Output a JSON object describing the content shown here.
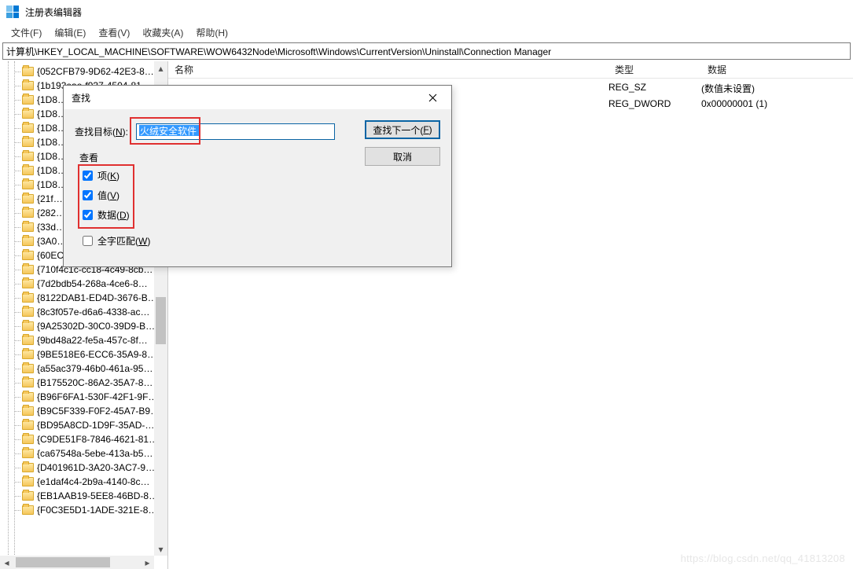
{
  "window": {
    "title": "注册表编辑器"
  },
  "menu": {
    "file": "文件(F)",
    "edit": "编辑(E)",
    "view": "查看(V)",
    "favorites": "收藏夹(A)",
    "help": "帮助(H)"
  },
  "address": "计算机\\HKEY_LOCAL_MACHINE\\SOFTWARE\\WOW6432Node\\Microsoft\\Windows\\CurrentVersion\\Uninstall\\Connection Manager",
  "tree": {
    "items": [
      "{052CFB79-9D62-42E3-8…",
      "{1b193eae-f937-4504-81…",
      "{1D8…",
      "{1D8…",
      "{1D8…",
      "{1D8…",
      "{1D8…",
      "{1D8…",
      "{1D8…",
      "{21f…",
      "{282…",
      "{33d…",
      "{3A0…",
      "{60EC980A-BDA2-4CB6-A…",
      "{710f4c1c-cc18-4c49-8cb…",
      "{7d2bdb54-268a-4ce6-8…",
      "{8122DAB1-ED4D-3676-B…",
      "{8c3f057e-d6a6-4338-ac…",
      "{9A25302D-30C0-39D9-B…",
      "{9bd48a22-fe5a-457c-8f…",
      "{9BE518E6-ECC6-35A9-8…",
      "{a55ac379-46b0-461a-95…",
      "{B175520C-86A2-35A7-8…",
      "{B96F6FA1-530F-42F1-9F…",
      "{B9C5F339-F0F2-45A7-B9…",
      "{BD95A8CD-1D9F-35AD-…",
      "{C9DE51F8-7846-4621-81…",
      "{ca67548a-5ebe-413a-b5…",
      "{D401961D-3A20-3AC7-9…",
      "{e1daf4c4-2b9a-4140-8c…",
      "{EB1AAB19-5EE8-46BD-8…",
      "{F0C3E5D1-1ADE-321E-8…"
    ]
  },
  "list": {
    "columns": {
      "name": "名称",
      "type": "类型",
      "data": "数据"
    },
    "rows": [
      {
        "type": "REG_SZ",
        "data": "(数值未设置)"
      },
      {
        "type": "REG_DWORD",
        "data": "0x00000001 (1)"
      }
    ]
  },
  "dialog": {
    "title": "查找",
    "target_label_pre": "查找目标(",
    "target_label_u": "N",
    "target_label_post": "):",
    "target_value": "火绒安全软件",
    "look_label": "查看",
    "chk_keys_pre": "项(",
    "chk_keys_u": "K",
    "chk_keys_post": ")",
    "chk_values_pre": "值(",
    "chk_values_u": "V",
    "chk_values_post": ")",
    "chk_data_pre": "数据(",
    "chk_data_u": "D",
    "chk_data_post": ")",
    "chk_whole_pre": "全字匹配(",
    "chk_whole_u": "W",
    "chk_whole_post": ")",
    "btn_findnext_pre": "查找下一个(",
    "btn_findnext_u": "F",
    "btn_findnext_post": ")",
    "btn_cancel": "取消"
  },
  "watermark": "https://blog.csdn.net/qq_41813208"
}
